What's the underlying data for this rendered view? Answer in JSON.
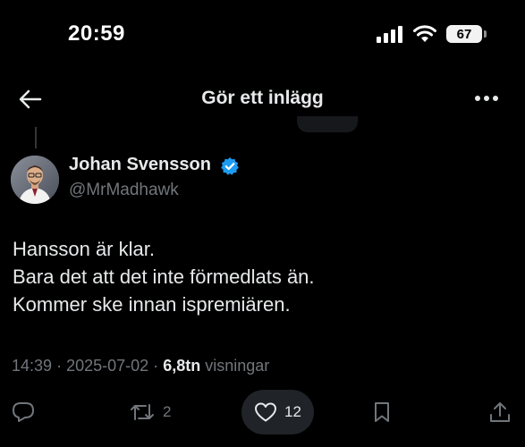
{
  "status_bar": {
    "time": "20:59",
    "battery": "67"
  },
  "nav": {
    "title": "Gör ett inlägg"
  },
  "author": {
    "name": "Johan Svensson",
    "handle": "@MrMadhawk"
  },
  "tweet": {
    "lines": [
      "Hansson är klar.",
      "Bara det att det inte förmedlats än.",
      "Kommer ske innan ispremiären."
    ]
  },
  "meta": {
    "time": "14:39",
    "sep1": "·",
    "date": "2025-07-02",
    "sep2": "·",
    "views_count": "6,8tn",
    "views_label": "visningar"
  },
  "actions": {
    "retweets": "2",
    "likes": "12"
  },
  "colors": {
    "background": "#000000",
    "text": "#e7e9ea",
    "muted": "#71767b",
    "verified": "#1d9bf0",
    "pill": "#202327"
  }
}
